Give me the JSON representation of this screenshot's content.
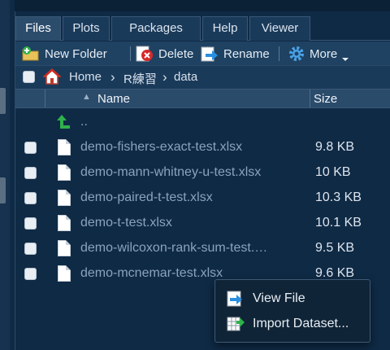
{
  "tabs": [
    "Files",
    "Plots",
    "Packages",
    "Help",
    "Viewer"
  ],
  "active_tab": "Files",
  "toolbar": {
    "new_folder": "New Folder",
    "delete": "Delete",
    "rename": "Rename",
    "more": "More"
  },
  "breadcrumb": {
    "home": "Home",
    "sep": "›",
    "folder1": "R練習",
    "folder2": "data"
  },
  "table": {
    "col_name": "Name",
    "col_size": "Size",
    "sort_indicator": "▲",
    "parent_row": "..",
    "files": [
      {
        "name": "demo-fishers-exact-test.xlsx",
        "size": "9.8 KB"
      },
      {
        "name": "demo-mann-whitney-u-test.xlsx",
        "size": "10 KB"
      },
      {
        "name": "demo-paired-t-test.xlsx",
        "size": "10.3 KB"
      },
      {
        "name": "demo-t-test.xlsx",
        "size": "10.1 KB"
      },
      {
        "name": "demo-wilcoxon-rank-sum-test.…",
        "size": "9.5 KB"
      },
      {
        "name": "demo-mcnemar-test.xlsx",
        "size": "9.6 KB"
      }
    ]
  },
  "context_menu": {
    "view_file": "View File",
    "import_dataset": "Import Dataset..."
  },
  "colors": {
    "background": "#0f2a45",
    "file_link": "#8aa3bd",
    "up_arrow": "#2fb24b",
    "gear": "#4aa3e8"
  }
}
